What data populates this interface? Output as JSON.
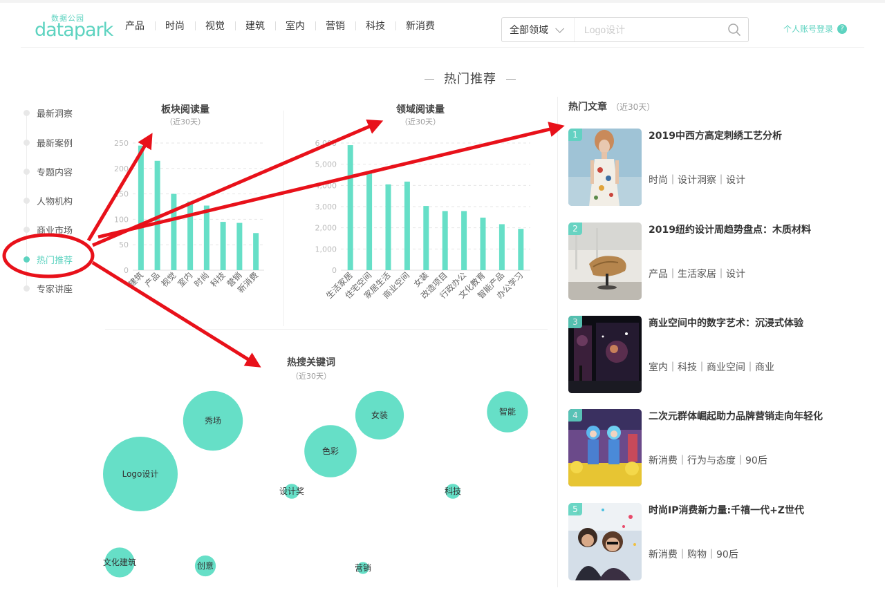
{
  "header": {
    "logo_cn": "数据公园",
    "logo_en": "datapark",
    "nav": [
      "产品",
      "时尚",
      "视觉",
      "建筑",
      "室内",
      "营销",
      "科技",
      "新消费"
    ],
    "search": {
      "category": "全部领域",
      "placeholder": "Logo设计"
    },
    "login": "个人账号登录",
    "help": "?"
  },
  "section_title": "热门推荐",
  "sidebar": {
    "items": [
      {
        "label": "最新洞察",
        "active": false
      },
      {
        "label": "最新案例",
        "active": false
      },
      {
        "label": "专题内容",
        "active": false
      },
      {
        "label": "人物机构",
        "active": false
      },
      {
        "label": "商业市场",
        "active": false
      },
      {
        "label": "热门推荐",
        "active": true
      },
      {
        "label": "专家讲座",
        "active": false
      }
    ]
  },
  "chart_data": [
    {
      "type": "bar",
      "title": "板块阅读量",
      "subtitle": "（近30天）",
      "categories": [
        "建筑",
        "产品",
        "视觉",
        "室内",
        "时尚",
        "科技",
        "营销",
        "新消费"
      ],
      "values": [
        245,
        215,
        150,
        135,
        127,
        95,
        93,
        73
      ],
      "ylim": [
        0,
        250
      ],
      "yticks": [
        "0",
        "50",
        "100",
        "150",
        "200",
        "250"
      ],
      "grid": true,
      "color": "#66dfc7"
    },
    {
      "type": "bar",
      "title": "领域阅读量",
      "subtitle": "（近30天）",
      "categories": [
        "生活家居",
        "住宅空间",
        "家居生活",
        "商业空间",
        "女装",
        "改造项目",
        "行政办公",
        "文化教育",
        "智能产品",
        "办公学习"
      ],
      "values": [
        5900,
        4680,
        4050,
        4180,
        3030,
        2790,
        2790,
        2480,
        2170,
        1950
      ],
      "ylim": [
        0,
        6000
      ],
      "yticks": [
        "0",
        "1,000",
        "2,000",
        "3,000",
        "4,000",
        "5,000",
        "6,000"
      ],
      "grid": true,
      "color": "#66dfc7"
    },
    {
      "type": "scatter",
      "title": "热搜关键词",
      "subtitle": "（近30天）",
      "bubbles": [
        {
          "label": "Logo设计",
          "size": 100
        },
        {
          "label": "秀场",
          "size": 80
        },
        {
          "label": "色彩",
          "size": 70
        },
        {
          "label": "女装",
          "size": 65
        },
        {
          "label": "智能",
          "size": 55
        },
        {
          "label": "文化建筑",
          "size": 40
        },
        {
          "label": "创意",
          "size": 28
        },
        {
          "label": "设计奖",
          "size": 20
        },
        {
          "label": "科技",
          "size": 20
        },
        {
          "label": "营销",
          "size": 16
        }
      ],
      "color": "#66dfc7"
    }
  ],
  "articles_header": {
    "title": "热门文章",
    "subtitle": "（近30天）"
  },
  "articles": [
    {
      "rank": "1",
      "title": "2019中西方高定刺绣工艺分析",
      "tags": "时尚｜设计洞察｜设计"
    },
    {
      "rank": "2",
      "title": "2019纽约设计周趋势盘点：木质材料",
      "tags": "产品｜生活家居｜设计"
    },
    {
      "rank": "3",
      "title": "商业空间中的数字艺术：沉浸式体验",
      "tags": "室内｜科技｜商业空间｜商业"
    },
    {
      "rank": "4",
      "title": "二次元群体崛起助力品牌营销走向年轻化",
      "tags": "新消费｜行为与态度｜90后"
    },
    {
      "rank": "5",
      "title": "时尚IP消费新力量:千禧一代+Z世代",
      "tags": "新消费｜购物｜90后"
    }
  ],
  "annotation": {
    "color": "#e8111a"
  }
}
